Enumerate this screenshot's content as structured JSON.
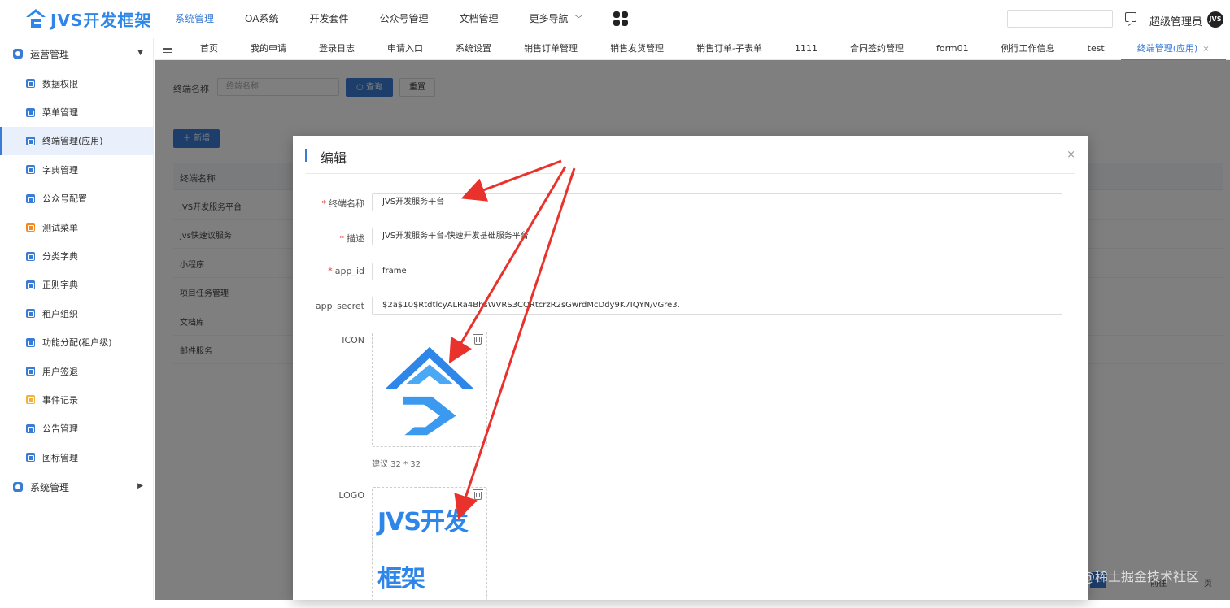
{
  "brand": {
    "name": "JVS开发框架"
  },
  "topnav": {
    "items": [
      "系统管理",
      "OA系统",
      "开发套件",
      "公众号管理",
      "文档管理",
      "更多导航"
    ],
    "user_name": "超级管理员",
    "avatar_text": "JVS"
  },
  "sidebar": {
    "groups": [
      {
        "label": "运营管理"
      },
      {
        "label": "系统管理"
      }
    ],
    "items": [
      {
        "label": "数据权限",
        "icon": "database-icon"
      },
      {
        "label": "菜单管理",
        "icon": "menu-icon"
      },
      {
        "label": "终端管理(应用)",
        "icon": "terminal-icon"
      },
      {
        "label": "字典管理",
        "icon": "dictionary-icon"
      },
      {
        "label": "公众号配置",
        "icon": "qrcode-icon"
      },
      {
        "label": "测试菜单",
        "icon": "home-icon"
      },
      {
        "label": "分类字典",
        "icon": "category-icon"
      },
      {
        "label": "正则字典",
        "icon": "regex-icon"
      },
      {
        "label": "租户组织",
        "icon": "org-icon"
      },
      {
        "label": "功能分配(租户级)",
        "icon": "shield-icon"
      },
      {
        "label": "用户签退",
        "icon": "logout-icon"
      },
      {
        "label": "事件记录",
        "icon": "log-icon"
      },
      {
        "label": "公告管理",
        "icon": "notice-icon"
      },
      {
        "label": "图标管理",
        "icon": "icon-manage-icon"
      }
    ]
  },
  "tabs": [
    "首页",
    "我的申请",
    "登录日志",
    "申请入口",
    "系统设置",
    "销售订单管理",
    "销售发货管理",
    "销售订单-子表单",
    "1111",
    "合同签约管理",
    "form01",
    "例行工作信息",
    "test",
    "终端管理(应用)"
  ],
  "tab_close": "×",
  "content": {
    "search_label": "终端名称",
    "search_placeholder": "终端名称",
    "query_label": "查询",
    "reset_label": "重置",
    "add_label": "新增",
    "table_header": "终端名称",
    "rows": [
      "JVS开发服务平台",
      "jvs快速议服务",
      "小程序",
      "项目任务管理",
      "文档库",
      "邮件服务"
    ],
    "pager_current": "1",
    "pager_goto": "前往",
    "pager_input": "1",
    "pager_unit": "页"
  },
  "modal": {
    "title": "编辑",
    "close": "×",
    "fields": {
      "name_label": "终端名称",
      "name_value": "JVS开发服务平台",
      "desc_label": "描述",
      "desc_value": "JVS开发服务平台-快速开发基础服务平台",
      "appid_label": "app_id",
      "appid_value": "frame",
      "secret_label": "app_secret",
      "secret_value": "$2a$10$RtdtlcyALRa4BhsWVRS3CORtcrzR2sGwrdMcDdy9K7IQYN/vGre3.",
      "icon_label": "ICON",
      "icon_hint": "建议 32 * 32",
      "logo_label": "LOGO",
      "logo_text": "JVS开发框架"
    }
  },
  "watermark": "@稀土掘金技术社区",
  "colors": {
    "accent": "#3a7bd5",
    "arrow": "#e8322b",
    "required": "#e53935"
  }
}
